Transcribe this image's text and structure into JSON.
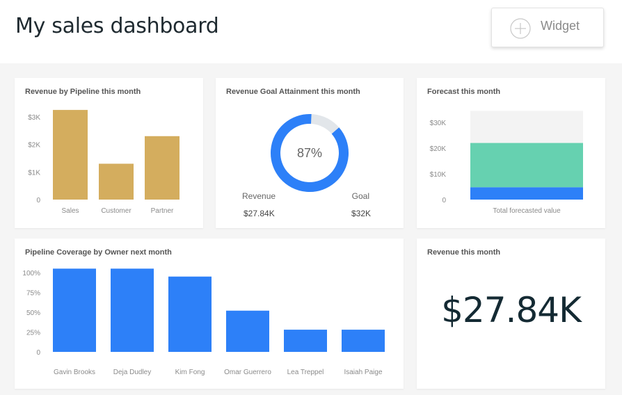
{
  "header": {
    "title": "My sales dashboard",
    "widget_button_label": "Widget"
  },
  "colors": {
    "gold": "#d4ad5e",
    "blue": "#2d80f8",
    "teal": "#66d1b0",
    "track": "#e2e6ea",
    "muted": "#f3f3f3"
  },
  "cards": {
    "revenue_by_pipeline": {
      "title": "Revenue by Pipeline this month",
      "chart_data": {
        "type": "bar",
        "categories": [
          "Sales",
          "Customer",
          "Partner"
        ],
        "values": [
          3250,
          1300,
          2300
        ],
        "y_ticks": [
          "$3K",
          "$2K",
          "$1K",
          "0"
        ],
        "y_tick_values": [
          3000,
          2000,
          1000,
          0
        ],
        "ylim": [
          0,
          3000
        ],
        "color": "#d4ad5e"
      }
    },
    "goal_attainment": {
      "title": "Revenue Goal Attainment this month",
      "chart_data": {
        "type": "donut",
        "percent": 87,
        "center_label": "87%",
        "left_label": "Revenue",
        "left_value": "$27.84K",
        "right_label": "Goal",
        "right_value": "$32K"
      }
    },
    "forecast": {
      "title": "Forecast this month",
      "chart_data": {
        "type": "bar",
        "stacked": true,
        "categories": [
          "Total forecasted value"
        ],
        "series": [
          {
            "values": [
              4800
            ]
          },
          {
            "values": [
              17200
            ]
          }
        ],
        "total": 34500,
        "y_ticks": [
          "$30K",
          "$20K",
          "$10K",
          "0"
        ],
        "y_tick_values": [
          30000,
          20000,
          10000,
          0
        ],
        "ylim": [
          0,
          30000
        ]
      }
    },
    "pipeline_coverage": {
      "title": "Pipeline Coverage by Owner next month",
      "chart_data": {
        "type": "bar",
        "categories": [
          "Gavin Brooks",
          "Deja Dudley",
          "Kim Fong",
          "Omar Guerrero",
          "Lea Treppel",
          "Isaiah Paige"
        ],
        "values": [
          105,
          105,
          95,
          52,
          28,
          28
        ],
        "y_ticks": [
          "100%",
          "75%",
          "50%",
          "25%",
          "0"
        ],
        "y_tick_values": [
          100,
          75,
          50,
          25,
          0
        ],
        "ylim": [
          0,
          100
        ],
        "color": "#2d80f8"
      }
    },
    "revenue_this_month": {
      "title": "Revenue this month",
      "value": "$27.84K"
    }
  }
}
